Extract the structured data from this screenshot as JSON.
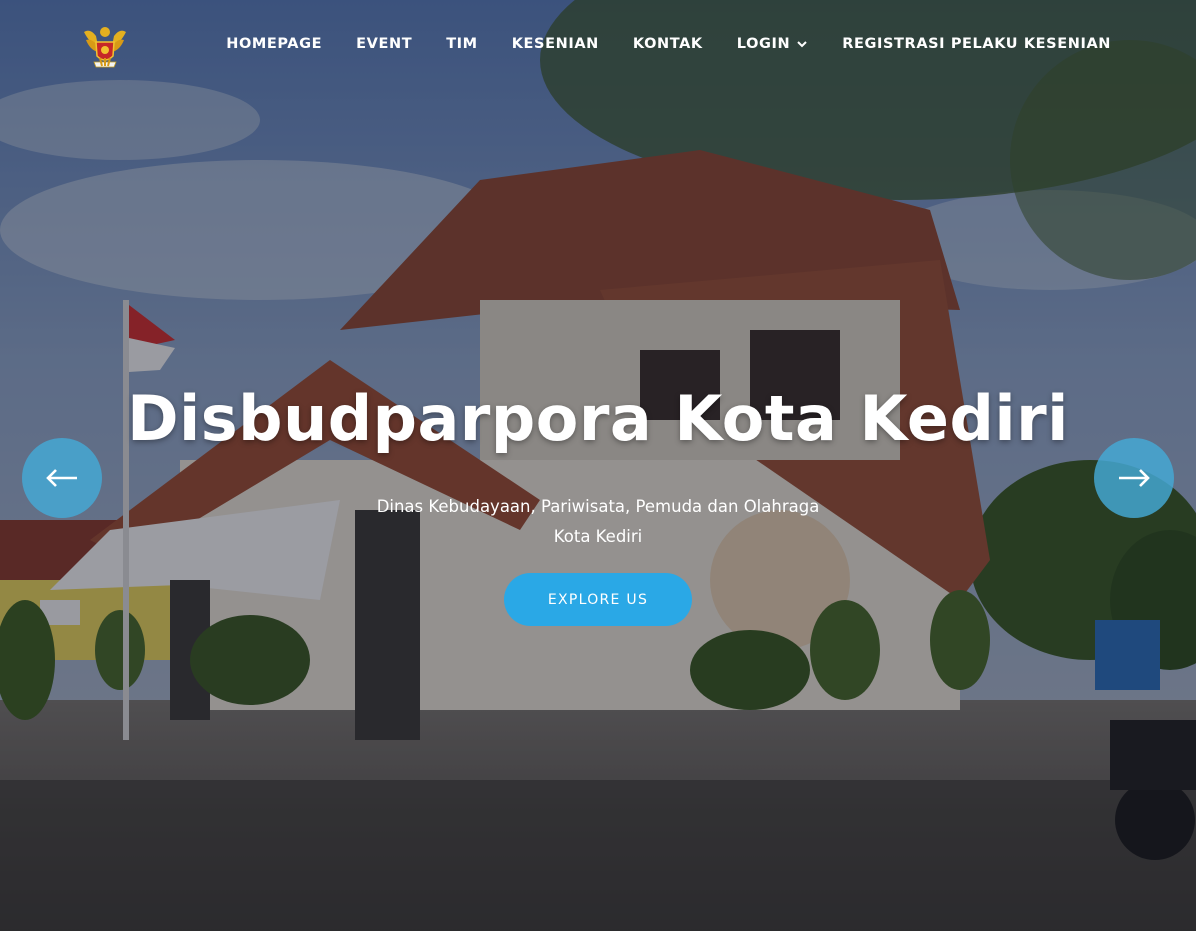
{
  "header": {
    "logo_icon": "garuda-emblem-icon",
    "nav": [
      {
        "label": "HOMEPAGE"
      },
      {
        "label": "EVENT"
      },
      {
        "label": "TIM"
      },
      {
        "label": "KESENIAN"
      },
      {
        "label": "KONTAK"
      },
      {
        "label": "LOGIN",
        "has_dropdown": true
      },
      {
        "label": "REGISTRASI PELAKU KESENIAN"
      }
    ]
  },
  "hero": {
    "title": "Disbudparpora Kota Kediri",
    "subtitle_line1": "Dinas Kebudayaan, Pariwisata, Pemuda dan Olahraga",
    "subtitle_line2": "Kota Kediri",
    "cta_label": "EXPLORE US",
    "prev_icon": "arrow-left-icon",
    "next_icon": "arrow-right-icon",
    "background": "photo of Disbudparpora office building"
  },
  "colors": {
    "accent": "#2aa8e6",
    "arrow_bg": "#44aad7",
    "text": "#ffffff"
  }
}
